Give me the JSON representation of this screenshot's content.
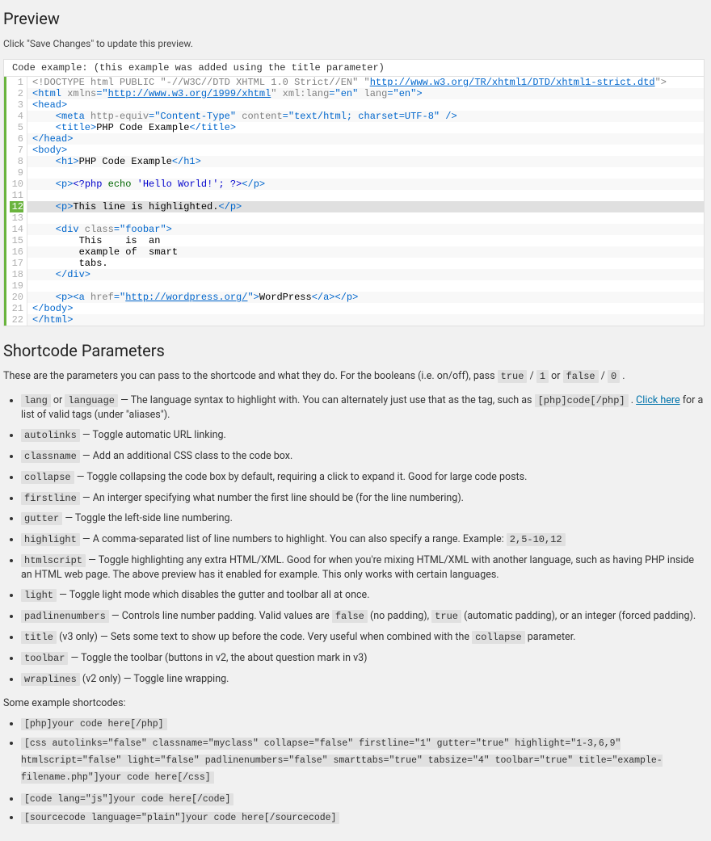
{
  "preview": {
    "heading": "Preview",
    "help": "Click \"Save Changes\" to update this preview.",
    "title": "Code example: (this example was added using the title parameter)",
    "line_count": 22,
    "highlighted": [
      12
    ]
  },
  "code": {
    "l1a": "<!DOCTYPE",
    "l1b": " html ",
    "l1c": "PUBLIC",
    "l1d": " \"-//W3C//DTD XHTML 1.0 Strict//EN\" \"",
    "l1e": "http://www.w3.org/TR/xhtml1/DTD/xhtml1-strict.dtd",
    "l1f": "\">",
    "l2a": "<html",
    "l2b": " xmlns",
    "l2c": "=\"",
    "l2d": "http://www.w3.org/1999/xhtml",
    "l2e": "\" xml:lang",
    "l2f": "=\"en\"",
    "l2g": " lang",
    "l2h": "=\"en\"",
    "l2i": ">",
    "l3": "<head>",
    "l4a": "    <meta",
    "l4b": " http-equiv",
    "l4c": "=",
    "l4d": "\"Content-Type\"",
    "l4e": " content",
    "l4f": "=",
    "l4g": "\"text/html; charset=UTF-8\"",
    "l4h": " />",
    "l5a": "    <title>",
    "l5b": "PHP Code Example",
    "l5c": "</title>",
    "l6": "</head>",
    "l7": "<body>",
    "l8a": "    <h1>",
    "l8b": "PHP Code Example",
    "l8c": "</h1>",
    "l10a": "    <p>",
    "l10b": "<?php ",
    "l10c": "echo ",
    "l10d": "'Hello World!'",
    "l10e": "; ",
    "l10f": "?>",
    "l10g": "</p>",
    "l12a": "    <p>",
    "l12b": "This line is highlighted.",
    "l12c": "</p>",
    "l14a": "    <div",
    "l14b": " class",
    "l14c": "=",
    "l14d": "\"foobar\"",
    "l14e": ">",
    "l15": "        This    is  an",
    "l16": "        example of  smart",
    "l17": "        tabs.",
    "l18": "    </div>",
    "l20a": "    <p><a",
    "l20b": " href",
    "l20c": "=\"",
    "l20d": "http://wordpress.org/",
    "l20e": "\">",
    "l20f": "WordPress",
    "l20g": "</a></p>",
    "l21": "</body>",
    "l22": "</html>"
  },
  "shortcode": {
    "heading": "Shortcode Parameters",
    "intro_a": "These are the parameters you can pass to the shortcode and what they do. For the booleans (i.e. on/off), pass ",
    "intro_true": "true",
    "intro_slash1": " / ",
    "intro_one": "1",
    "intro_or": " or ",
    "intro_false": "false",
    "intro_slash2": " / ",
    "intro_zero": "0",
    "intro_end": " .",
    "click_here": "Click here"
  },
  "params": {
    "lang": {
      "k1": "lang",
      "or": " or ",
      "k2": "language",
      "desc": " — The language syntax to highlight with. You can alternately just use that as the tag, such as ",
      "ex": "[php]code[/php]",
      "after": " . ",
      "tail": " for a list of valid tags (under \"aliases\")."
    },
    "autolinks": {
      "k": "autolinks",
      "d": " — Toggle automatic URL linking."
    },
    "classname": {
      "k": "classname",
      "d": " — Add an additional CSS class to the code box."
    },
    "collapse": {
      "k": "collapse",
      "d": " — Toggle collapsing the code box by default, requiring a click to expand it. Good for large code posts."
    },
    "firstline": {
      "k": "firstline",
      "d": " — An interger specifying what number the first line should be (for the line numbering)."
    },
    "gutter": {
      "k": "gutter",
      "d": " — Toggle the left-side line numbering."
    },
    "highlight": {
      "k": "highlight",
      "d": " — A comma-separated list of line numbers to highlight. You can also specify a range. Example: ",
      "ex": "2,5-10,12"
    },
    "htmlscript": {
      "k": "htmlscript",
      "d": " — Toggle highlighting any extra HTML/XML. Good for when you're mixing HTML/XML with another language, such as having PHP inside an HTML web page. The above preview has it enabled for example. This only works with certain languages."
    },
    "light": {
      "k": "light",
      "d": " — Toggle light mode which disables the gutter and toolbar all at once."
    },
    "padlinenumbers": {
      "k": "padlinenumbers",
      "d1": " — Controls line number padding. Valid values are ",
      "v1": "false",
      "d2": " (no padding), ",
      "v2": "true",
      "d3": " (automatic padding), or an integer (forced padding)."
    },
    "title": {
      "k": "title",
      "d1": " (v3 only) — Sets some text to show up before the code. Very useful when combined with the ",
      "v": "collapse",
      "d2": " parameter."
    },
    "toolbar": {
      "k": "toolbar",
      "d": " — Toggle the toolbar (buttons in v2, the about question mark in v3)"
    },
    "wraplines": {
      "k": "wraplines",
      "d": " (v2 only) — Toggle line wrapping."
    }
  },
  "examples": {
    "label": "Some example shortcodes:",
    "e1": "[php]your code here[/php]",
    "e2": "[css autolinks=\"false\" classname=\"myclass\" collapse=\"false\" firstline=\"1\" gutter=\"true\" highlight=\"1-3,6,9\" htmlscript=\"false\" light=\"false\" padlinenumbers=\"false\" smarttabs=\"true\" tabsize=\"4\" toolbar=\"true\" title=\"example-filename.php\"]your code here[/css]",
    "e3": "[code lang=\"js\"]your code here[/code]",
    "e4": "[sourcecode language=\"plain\"]your code here[/sourcecode]"
  }
}
